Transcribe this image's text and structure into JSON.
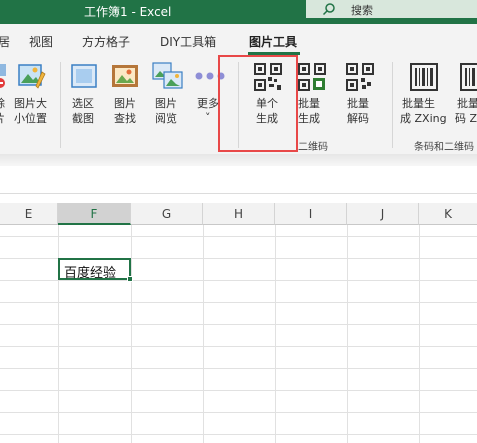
{
  "window": {
    "title": "工作簿1  -  Excel"
  },
  "search": {
    "label": "搜索"
  },
  "tabs": [
    {
      "label": "视图"
    },
    {
      "label": "方方格子"
    },
    {
      "label": "DIY工具箱"
    },
    {
      "label": "图片工具",
      "active": true
    }
  ],
  "tab_partial": "居",
  "ribbon": {
    "partial_left": {
      "top": "除",
      "bottom": "片"
    },
    "buttons": [
      {
        "line1": "图片大",
        "line2": "小位置"
      },
      {
        "line1": "选区",
        "line2": "截图"
      },
      {
        "line1": "图片",
        "line2": "查找"
      },
      {
        "line1": "图片",
        "line2": "阅览"
      },
      {
        "line1": "更多",
        "line2": "˅"
      },
      {
        "line1": "单个",
        "line2": "生成"
      },
      {
        "line1": "批量",
        "line2": "生成"
      },
      {
        "line1": "批量",
        "line2": "解码"
      },
      {
        "line1": "批量生",
        "line2": "成 ZXing"
      },
      {
        "line1": "批量",
        "line2": "码 ZX"
      }
    ],
    "groups": [
      {
        "label": "二维码"
      },
      {
        "label": "条码和二维码"
      }
    ]
  },
  "columns": [
    {
      "label": "E"
    },
    {
      "label": "F",
      "active": true
    },
    {
      "label": "G"
    },
    {
      "label": "H"
    },
    {
      "label": "I"
    },
    {
      "label": "J"
    },
    {
      "label": "K"
    }
  ],
  "active_cell": {
    "value": "百度经验"
  },
  "colors": {
    "accent": "#217346",
    "highlight": "#e84848"
  }
}
